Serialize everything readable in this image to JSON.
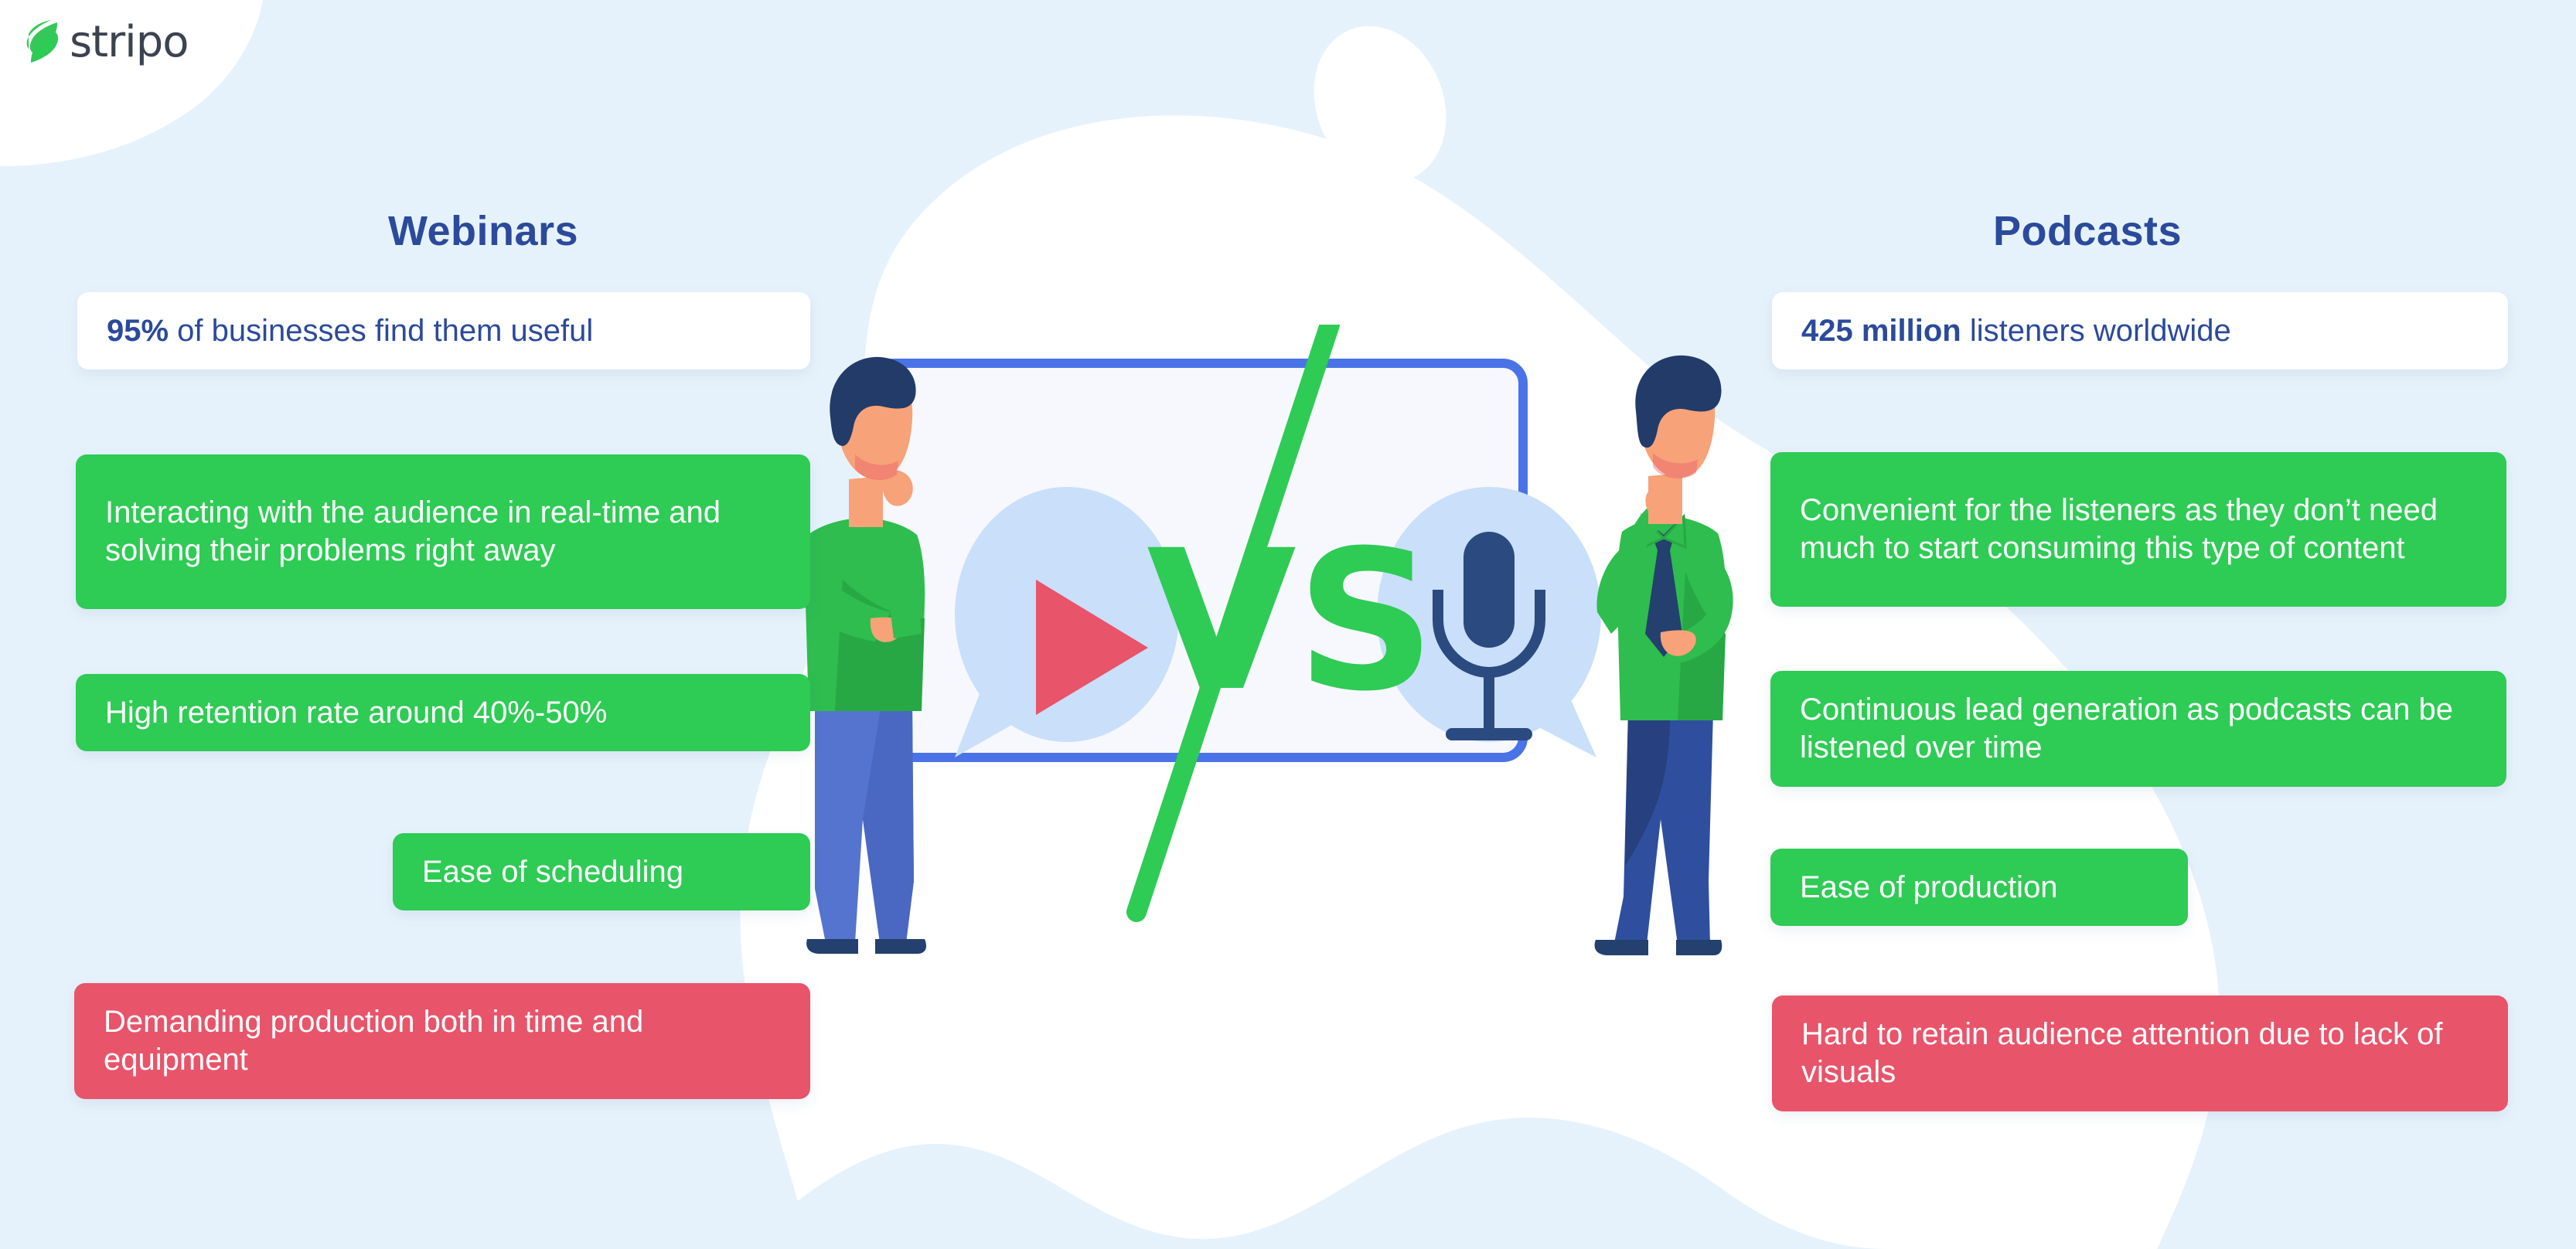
{
  "brand": {
    "logo_text": "stripo",
    "logo_mark": "stripo-lightning-icon",
    "logo_color": "#2ecb55",
    "logo_text_color": "#3c4350"
  },
  "theme": {
    "background": "#e6f2fb",
    "blob": "#ffffff",
    "title_color": "#2b4a9b",
    "positive": "#2ecb55",
    "negative": "#e8546a",
    "accent_blue": "#4a73e8",
    "bubble": "#c9dffa",
    "navy": "#2b4a80",
    "skin": "#f7a278"
  },
  "columns": {
    "left": {
      "title": "Webinars",
      "stat": {
        "highlight": "95%",
        "rest": " of businesses find them useful"
      },
      "points": [
        {
          "type": "pro",
          "text": "Interacting with the audience in real-time and solving their problems right away"
        },
        {
          "type": "pro",
          "text": "High retention rate around 40%-50%"
        },
        {
          "type": "pro",
          "text": "Ease of scheduling"
        },
        {
          "type": "con",
          "text": "Demanding production both in time and equipment"
        }
      ]
    },
    "right": {
      "title": "Podcasts",
      "stat": {
        "highlight": "425 million",
        "rest": " listeners worldwide"
      },
      "points": [
        {
          "type": "pro",
          "text": "Convenient for the listeners as they don’t need much to start consuming this type of content"
        },
        {
          "type": "pro",
          "text": "Continuous lead generation as podcasts can be listened over time"
        },
        {
          "type": "pro",
          "text": "Ease of production"
        },
        {
          "type": "con",
          "text": "Hard to retain audience attention due to lack of visuals"
        }
      ]
    }
  },
  "illustration": {
    "vs_label": "VS",
    "screen": "presentation-screen",
    "left_bubble_icon": "play-button-icon",
    "right_bubble_icon": "microphone-icon",
    "divider": "green-diagonal-slash",
    "left_character": "thinking-man-in-green-sweater",
    "right_character": "puzzled-man-in-green-shirt-with-tie"
  }
}
